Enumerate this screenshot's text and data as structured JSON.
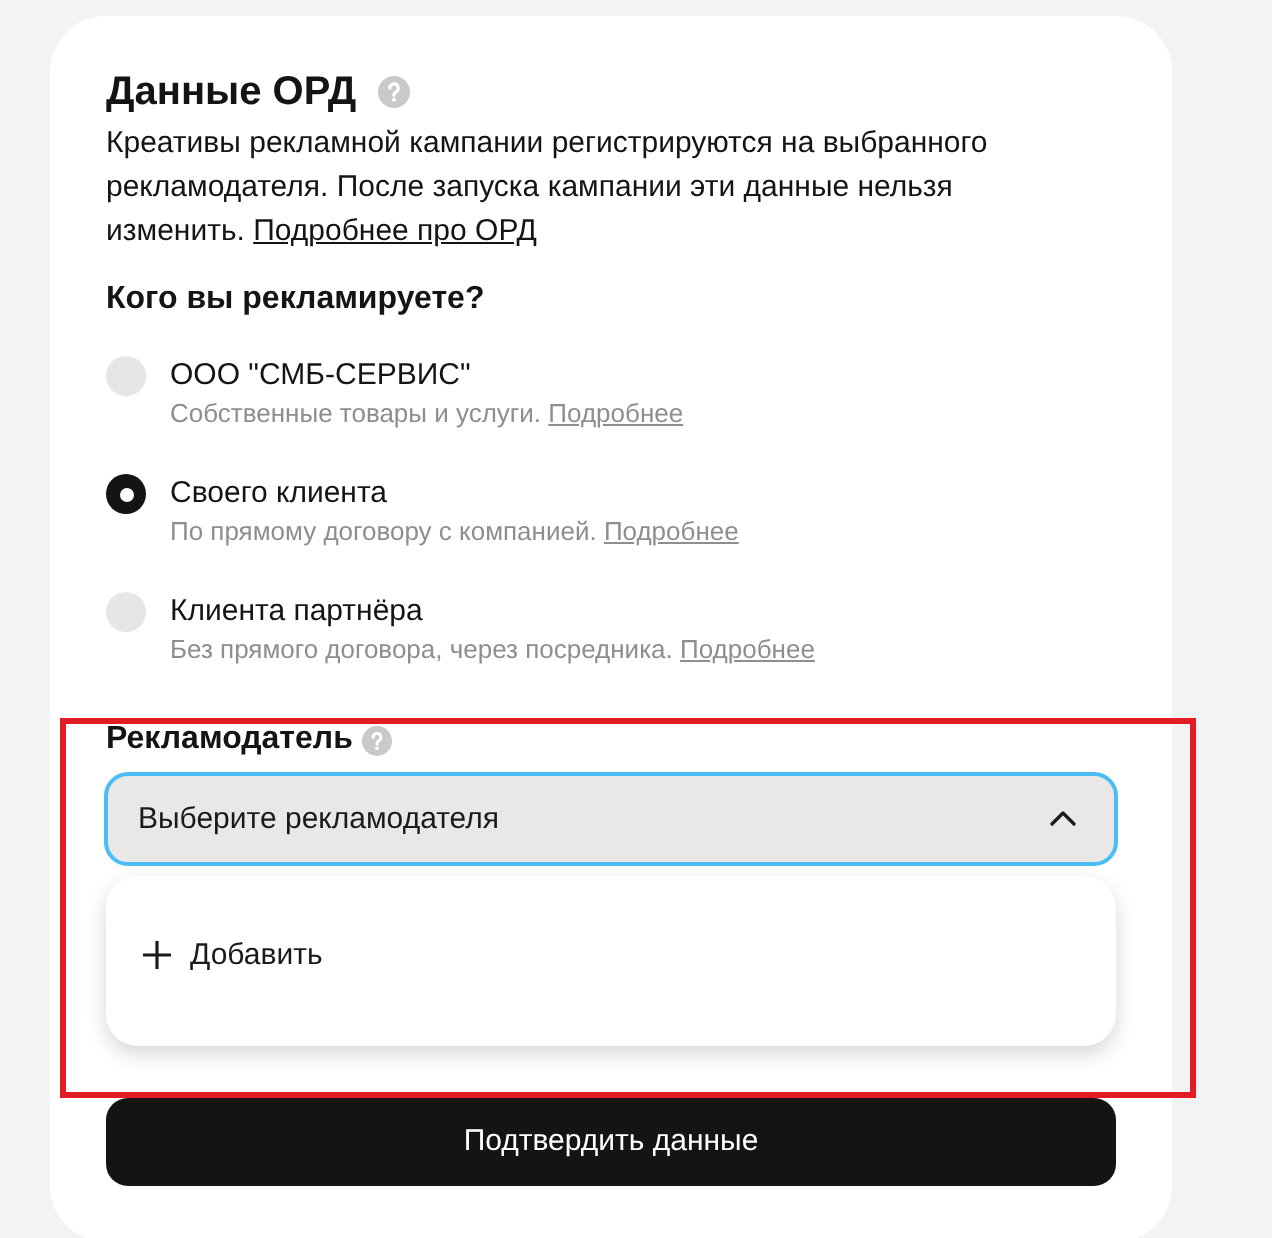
{
  "header": {
    "title": "Данные ОРД",
    "description": "Креативы рекламной кампании регистрируются на выбранного рекламодателя. После запуска кампании эти данные нельзя изменить.",
    "description_link": "Подробнее про ОРД"
  },
  "question": "Кого вы рекламируете?",
  "options": [
    {
      "title": "ООО \"СМБ-СЕРВИС\"",
      "subtitle": "Собственные товары и услуги.",
      "link": "Подробнее",
      "selected": false
    },
    {
      "title": "Своего клиента",
      "subtitle": "По прямому договору с компанией.",
      "link": "Подробнее",
      "selected": true
    },
    {
      "title": "Клиента партнёра",
      "subtitle": "Без прямого договора, через посредника.",
      "link": "Подробнее",
      "selected": false
    }
  ],
  "advertiser": {
    "label": "Рекламодатель",
    "placeholder": "Выберите рекламодателя",
    "expanded": true,
    "menu_items": [
      {
        "label": "Добавить"
      }
    ]
  },
  "submit_button": {
    "label": "Подтвердить данные"
  }
}
